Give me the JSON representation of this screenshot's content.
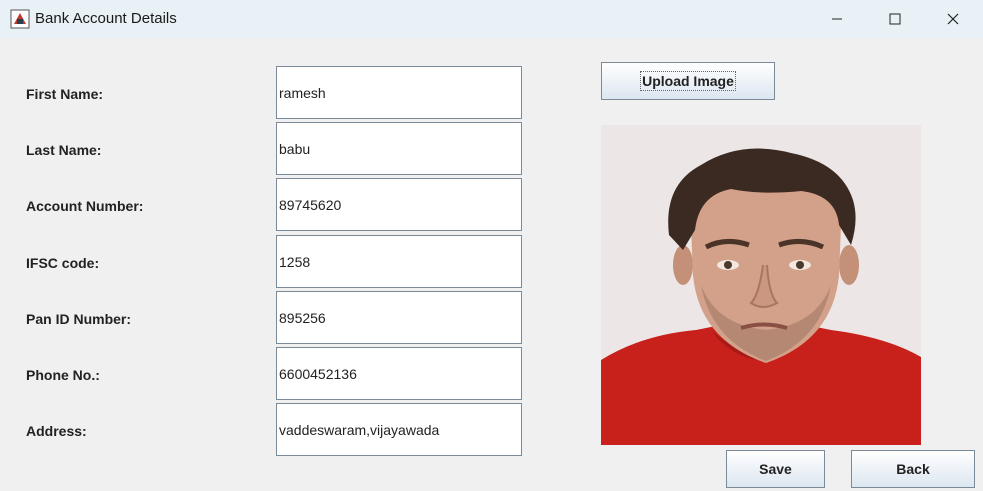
{
  "window": {
    "title": "Bank Account Details",
    "icon": "java-app-icon"
  },
  "form": {
    "fields": [
      {
        "label": "First Name:",
        "value": "ramesh"
      },
      {
        "label": "Last Name:",
        "value": "babu"
      },
      {
        "label": "Account Number:",
        "value": "89745620"
      },
      {
        "label": "IFSC code:",
        "value": "1258"
      },
      {
        "label": "Pan ID Number:",
        "value": "895256"
      },
      {
        "label": "Phone No.:",
        "value": "6600452136"
      },
      {
        "label": "Address:",
        "value": "vaddeswaram,vijayawada"
      }
    ]
  },
  "buttons": {
    "upload": "Upload Image",
    "save": "Save",
    "back": "Back"
  },
  "photo": {
    "subject": "person-portrait",
    "shirt_color": "#c8211c",
    "background_color": "#ece7e6"
  }
}
